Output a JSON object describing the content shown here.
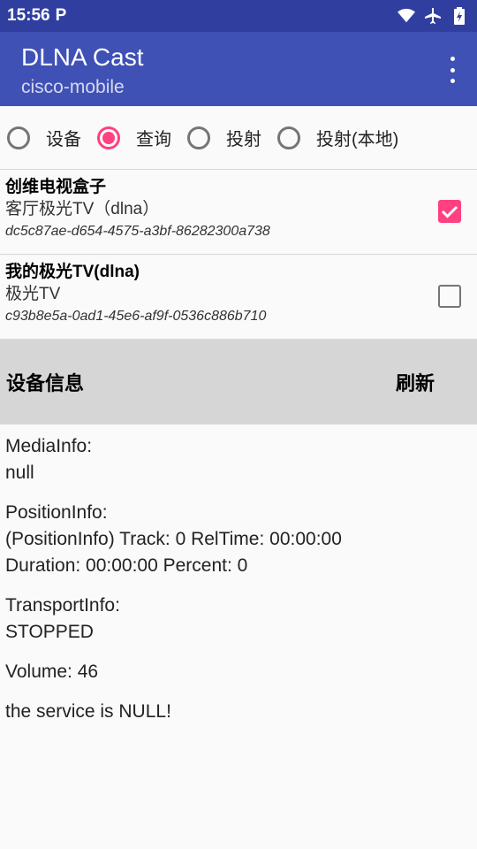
{
  "status": {
    "time": "15:56",
    "p_icon": "P"
  },
  "app": {
    "title": "DLNA Cast",
    "subtitle": "cisco-mobile"
  },
  "radios": [
    {
      "label": "设备",
      "checked": false
    },
    {
      "label": "查询",
      "checked": true
    },
    {
      "label": "投射",
      "checked": false
    },
    {
      "label": "投射(本地)",
      "checked": false
    }
  ],
  "devices": [
    {
      "name": "创维电视盒子",
      "sub": "客厅极光TV（dlna）",
      "id": "dc5c87ae-d654-4575-a3bf-86282300a738",
      "checked": true
    },
    {
      "name": "我的极光TV(dlna)",
      "sub": "极光TV",
      "id": "c93b8e5a-0ad1-45e6-af9f-0536c886b710",
      "checked": false
    }
  ],
  "info": {
    "title": "设备信息",
    "refresh": "刷新"
  },
  "content": {
    "media": "MediaInfo:\nnull",
    "position": "PositionInfo:\n(PositionInfo) Track: 0 RelTime: 00:00:00\nDuration: 00:00:00 Percent: 0",
    "transport": "TransportInfo:\nSTOPPED",
    "volume": "Volume: 46",
    "service": "the service is NULL!"
  },
  "colors": {
    "statusbar": "#303f9f",
    "appbar": "#3f51b5",
    "accent": "#ff4081"
  }
}
